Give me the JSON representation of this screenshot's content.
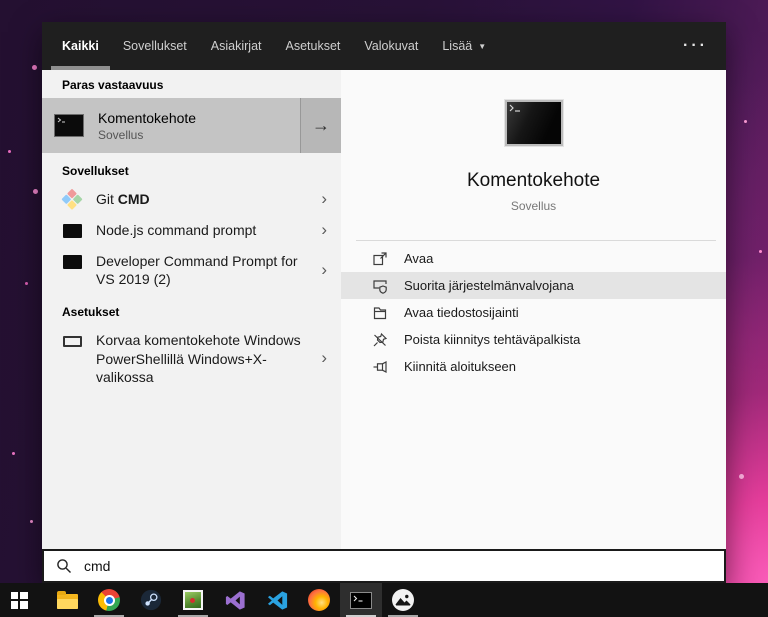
{
  "tabs": {
    "items": [
      {
        "label": "Kaikki",
        "active": true
      },
      {
        "label": "Sovellukset",
        "active": false
      },
      {
        "label": "Asiakirjat",
        "active": false
      },
      {
        "label": "Asetukset",
        "active": false
      },
      {
        "label": "Valokuvat",
        "active": false
      },
      {
        "label": "Lisää",
        "active": false,
        "has_dropdown": true
      }
    ],
    "ellipsis": "···"
  },
  "icons": {
    "dropdown_arrow": "▼",
    "arrow_right": "→",
    "chevron_right": "›"
  },
  "left": {
    "best_match_heading": "Paras vastaavuus",
    "best_match": {
      "title": "Komentokehote",
      "subtitle": "Sovellus"
    },
    "apps_heading": "Sovellukset",
    "apps": [
      {
        "prefix": "Git ",
        "match": "CMD"
      },
      {
        "label": "Node.js command prompt"
      },
      {
        "label": "Developer Command Prompt for VS 2019 (2)"
      }
    ],
    "settings_heading": "Asetukset",
    "settings": [
      {
        "label": "Korvaa komentokehote Windows PowerShellillä Windows+X-valikossa"
      }
    ]
  },
  "right": {
    "title": "Komentokehote",
    "subtitle": "Sovellus",
    "actions": [
      {
        "label": "Avaa",
        "icon": "open-icon",
        "highlighted": false
      },
      {
        "label": "Suorita järjestelmänvalvojana",
        "icon": "admin-shield-icon",
        "highlighted": true
      },
      {
        "label": "Avaa tiedostosijainti",
        "icon": "folder-icon",
        "highlighted": false
      },
      {
        "label": "Poista kiinnitys tehtäväpalkista",
        "icon": "unpin-icon",
        "highlighted": false
      },
      {
        "label": "Kiinnitä aloitukseen",
        "icon": "pin-icon",
        "highlighted": false
      }
    ]
  },
  "search": {
    "value": "cmd"
  },
  "taskbar": {
    "icons": [
      {
        "name": "start-button",
        "running": false
      },
      {
        "name": "file-explorer",
        "running": false
      },
      {
        "name": "chrome",
        "running": true
      },
      {
        "name": "steam",
        "running": false
      },
      {
        "name": "image-viewer",
        "running": true
      },
      {
        "name": "visual-studio",
        "running": false
      },
      {
        "name": "vs-code",
        "running": false
      },
      {
        "name": "firefox",
        "running": false
      },
      {
        "name": "command-prompt",
        "running": true,
        "active": true
      },
      {
        "name": "photos",
        "running": true
      }
    ]
  },
  "colors": {
    "tabbar_bg": "#1f1f1f",
    "left_panel_bg": "#f2f2f2",
    "right_panel_bg": "#fafafa",
    "best_match_highlight": "#c4c4c4",
    "action_highlight": "#e4e4e4",
    "taskbar_bg": "#121212",
    "desktop_purple": "#2a1237",
    "desktop_pink": "#f040a0"
  }
}
